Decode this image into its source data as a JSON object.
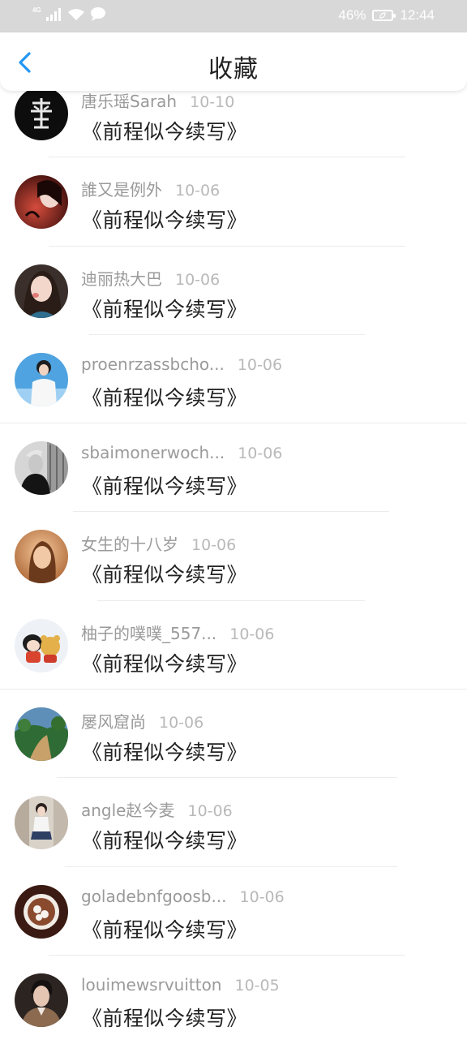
{
  "status_bar": {
    "network": "4G",
    "battery": "46%",
    "time": "12:44"
  },
  "header": {
    "title": "收藏",
    "back_icon": "chevron-left-icon",
    "accent_color": "#2196f3"
  },
  "items": [
    {
      "name": "唐乐瑶Sarah",
      "date": "10-10",
      "title": "《前程似今续写》",
      "avatar": "black-logo-avatar"
    },
    {
      "name": "誰又是例外",
      "date": "10-06",
      "title": "《前程似今续写》",
      "avatar": "red-portrait-avatar"
    },
    {
      "name": "迪丽热大巴",
      "date": "10-06",
      "title": "《前程似今续写》",
      "avatar": "girl-portrait-avatar"
    },
    {
      "name": "proenrzassbcho...",
      "date": "10-06",
      "title": "《前程似今续写》",
      "avatar": "sky-portrait-avatar"
    },
    {
      "name": "sbaimonerwoch...",
      "date": "10-06",
      "title": "《前程似今续写》",
      "avatar": "bw-portrait-avatar"
    },
    {
      "name": "女生的十八岁",
      "date": "10-06",
      "title": "《前程似今续写》",
      "avatar": "warm-portrait-avatar"
    },
    {
      "name": "柚子的噗噗_557...",
      "date": "10-06",
      "title": "《前程似今续写》",
      "avatar": "cartoon-avatar"
    },
    {
      "name": "屡风窟尚",
      "date": "10-06",
      "title": "《前程似今续写》",
      "avatar": "landscape-avatar"
    },
    {
      "name": "angle赵今麦",
      "date": "10-06",
      "title": "《前程似今续写》",
      "avatar": "street-portrait-avatar"
    },
    {
      "name": "goladebnfgoosb...",
      "date": "10-06",
      "title": "《前程似今续写》",
      "avatar": "coffee-avatar"
    },
    {
      "name": "louimewsrvuitton",
      "date": "10-05",
      "title": "《前程似今续写》",
      "avatar": "dark-portrait-avatar"
    }
  ]
}
